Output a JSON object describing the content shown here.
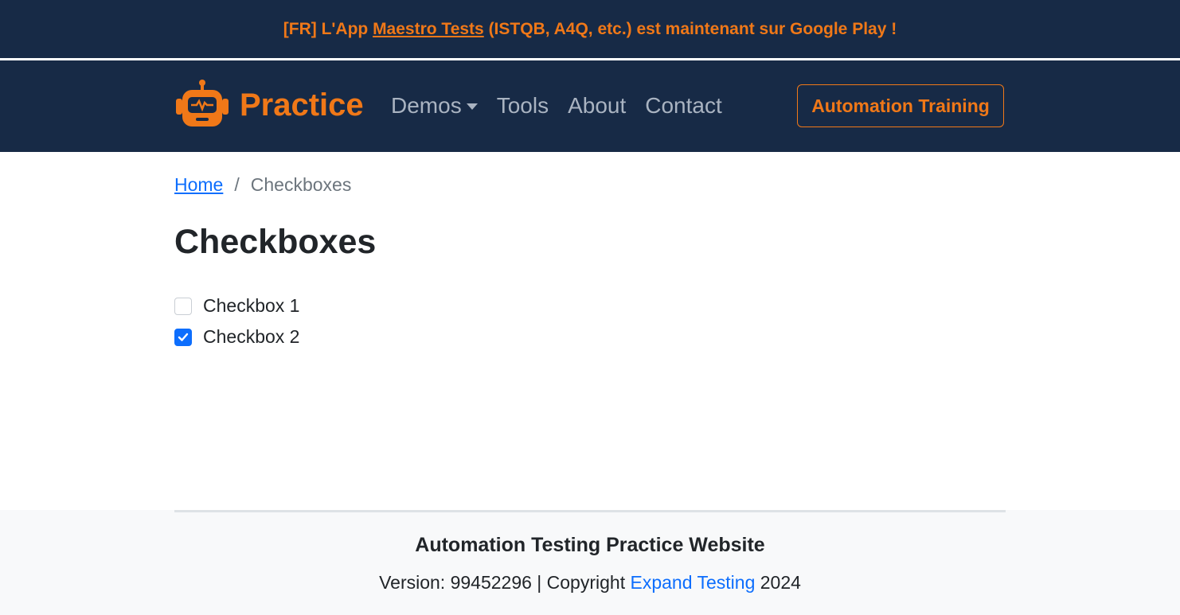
{
  "banner": {
    "prefix": "[FR] L'App ",
    "link": "Maestro Tests",
    "suffix": " (ISTQB, A4Q, etc.) est maintenant sur Google Play !"
  },
  "navbar": {
    "brand": "Practice",
    "brand_icon": "robot-icon",
    "links": [
      "Demos",
      "Tools",
      "About",
      "Contact"
    ],
    "cta": "Automation Training"
  },
  "breadcrumb": {
    "home": "Home",
    "separator": "/",
    "current": "Checkboxes"
  },
  "page": {
    "title": "Checkboxes",
    "checkboxes": [
      {
        "label": "Checkbox 1",
        "checked": false
      },
      {
        "label": "Checkbox 2",
        "checked": true
      }
    ]
  },
  "footer": {
    "title": "Automation Testing Practice Website",
    "version_prefix": "Version: 99452296 | Copyright ",
    "link": "Expand Testing",
    "year": " 2024"
  },
  "colors": {
    "navy": "#172a46",
    "orange": "#f07818",
    "link_blue": "#0d6efd"
  }
}
